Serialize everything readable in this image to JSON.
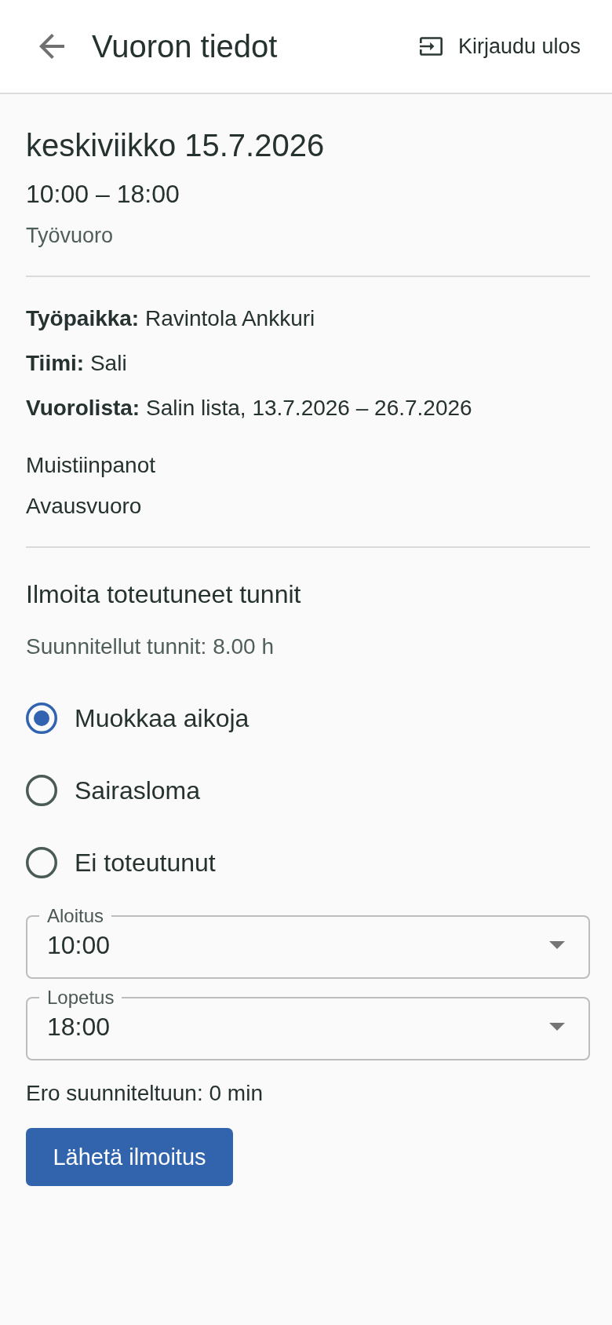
{
  "header": {
    "title": "Vuoron tiedot",
    "logout_label": "Kirjaudu ulos"
  },
  "shift": {
    "date": "keskiviikko 15.7.2026",
    "time": "10:00 – 18:00",
    "type": "Työvuoro"
  },
  "details": [
    "**Työpaikka:** Ravintola Ankkuri",
    "**Tiimi:** Sali",
    "**Vuorolista:** Salin lista, 13.7.2026 – 26.7.2026"
  ],
  "notes": {
    "heading": "Muistiinpanot",
    "text": "Avausvuoro"
  },
  "report": {
    "heading": "Ilmoita toteutuneet tunnit",
    "planned": "Suunnitellut tunnit: 8.00 h",
    "options": [
      {
        "label": "Muokkaa aikoja",
        "selected": true
      },
      {
        "label": "Sairasloma",
        "selected": false
      },
      {
        "label": "Ei toteutunut",
        "selected": false
      }
    ],
    "fields": [
      {
        "label": "Aloitus",
        "value": "10:00"
      },
      {
        "label": "Lopetus",
        "value": "18:00"
      }
    ],
    "difference": "Ero suunniteltuun: 0 min",
    "submit": "Lähetä ilmoitus"
  }
}
